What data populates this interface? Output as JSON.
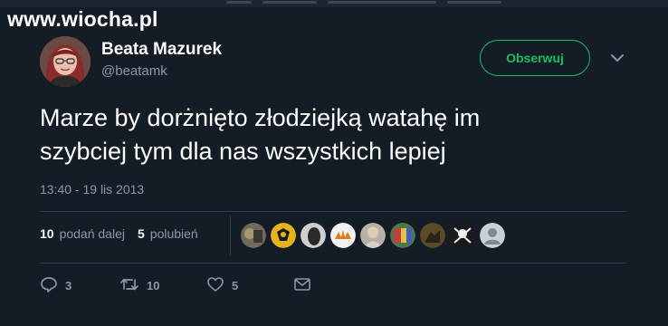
{
  "watermark": "www.wiocha.pl",
  "user": {
    "display_name": "Beata Mazurek",
    "handle": "@beatamk"
  },
  "follow_label": "Obserwuj",
  "tweet": {
    "line1": "Marze by dorżnięto złodziejką watahę im",
    "line2": "szybciej tym dla nas wszystkich lepiej"
  },
  "timestamp": "13:40 - 19 lis 2013",
  "stats": {
    "retweets_count": "10",
    "retweets_label": "podań dalej",
    "likes_count": "5",
    "likes_label": "polubień"
  },
  "actions": {
    "reply_count": "3",
    "retweet_count": "10",
    "like_count": "5"
  },
  "colors": {
    "background": "#141d26",
    "accent_green": "#17bf63",
    "secondary_text": "#8899a6"
  },
  "icons": [
    "chevron-down-icon",
    "reply-icon",
    "retweet-icon",
    "heart-icon",
    "message-icon"
  ]
}
